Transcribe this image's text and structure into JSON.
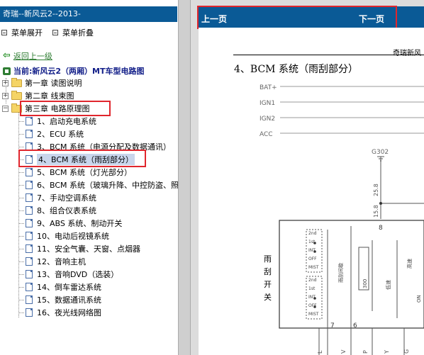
{
  "left_panel": {
    "title": "奇瑞--新风云2--2013-",
    "toolbar": {
      "expand_label": "菜单展开",
      "collapse_label": "菜单折叠"
    },
    "back_label": "返回上一级",
    "current_label": "当前:新风云2（两厢）MT车型电路图",
    "chapters": [
      {
        "label": "第一章 读图说明",
        "expanded": false
      },
      {
        "label": "第二章 线束图",
        "expanded": false
      },
      {
        "label": "第三章 电路原理图",
        "expanded": true
      }
    ],
    "items": [
      "1、启动充电系统",
      "2、ECU 系统",
      "3、BCM 系统（电源分配及数据通讯）",
      "4、BCM 系统（雨刮部分）",
      "5、BCM 系统（灯光部分）",
      "6、BCM 系统（玻璃升降、中控防盗、照",
      "7、手动空调系统",
      "8、组合仪表系统",
      "9、ABS 系统、制动开关",
      "10、电动后视镜系统",
      "11、安全气囊、天窗、点烟器",
      "12、音响主机",
      "13、音响DVD（选装）",
      "14、倒车雷达系统",
      "15、数据通讯系统",
      "16、夜光线网络图"
    ],
    "selected_index": 3
  },
  "right_panel": {
    "prev_label": "上一页",
    "next_label": "下一页",
    "brand": "奇瑞新风",
    "heading": "4、BCM 系统（雨刮部分）",
    "diagram": {
      "rails": [
        "BAT+",
        "IGN1",
        "IGN2",
        "ACC"
      ],
      "ground": "G302",
      "wire_labels": [
        "25.8",
        "15.8"
      ],
      "switch_label": [
        "雨",
        "刮",
        "开",
        "关"
      ],
      "switch_positions_top": [
        "2nd",
        "1st",
        "INT",
        "OFF",
        "MIST"
      ],
      "switch_positions_bottom": [
        "2nd",
        "1st",
        "INT",
        "OFF",
        "MIST"
      ],
      "pin_numbers": [
        "8",
        "7",
        "6"
      ],
      "bottom_labels": [
        "L",
        "V",
        "P",
        "Y",
        "G"
      ],
      "component_labels": [
        "300",
        "雨刮间歇",
        "高速",
        "低速",
        "ON"
      ]
    }
  },
  "colors": {
    "title_bar": "#0a5a96",
    "highlight_box": "#e0262d",
    "selection": "#c9d6ec"
  }
}
